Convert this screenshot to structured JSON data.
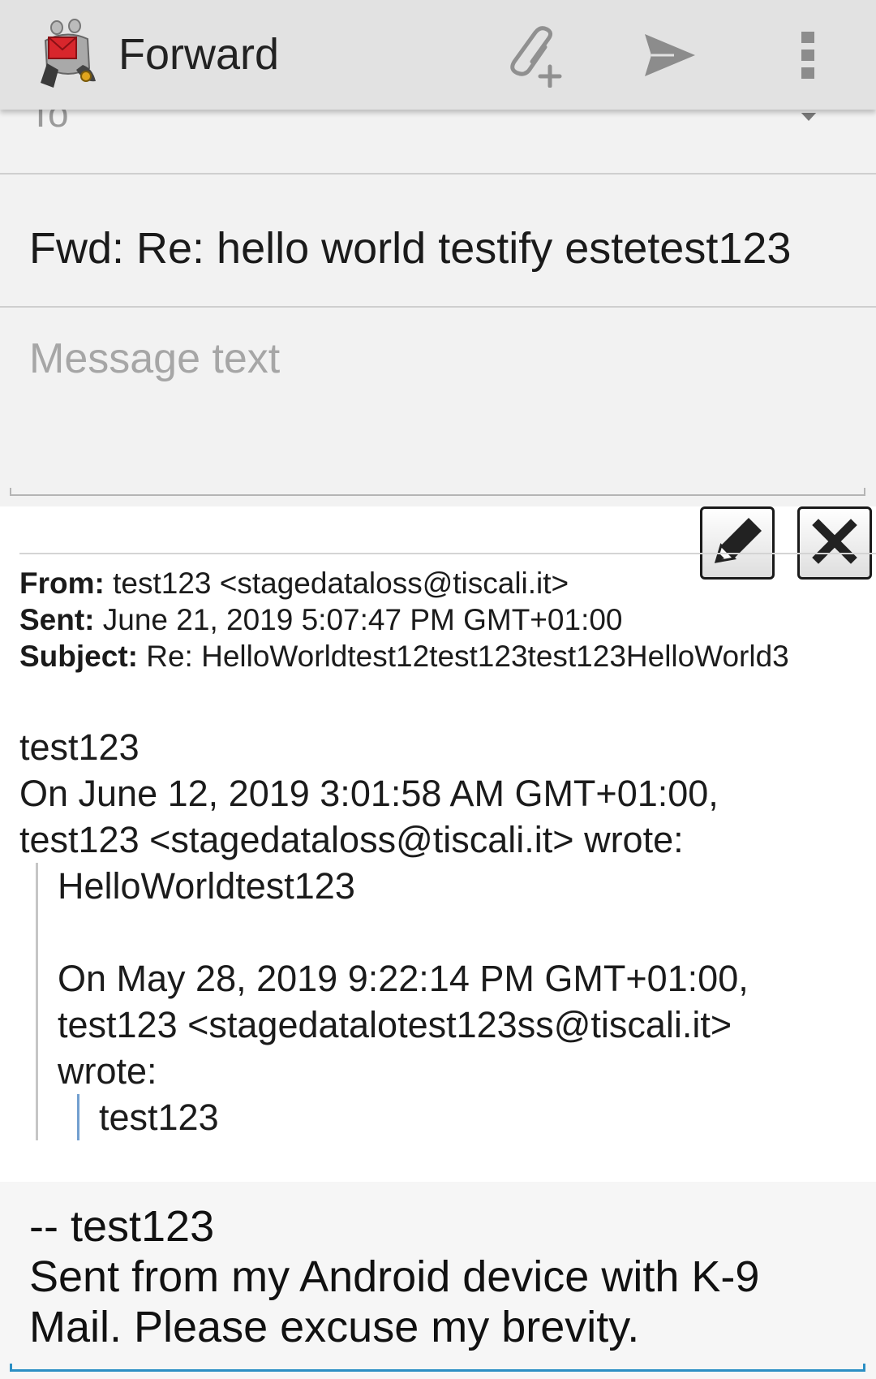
{
  "app_bar": {
    "title": "Forward",
    "logo_icon": "k9-mail-dog-logo",
    "actions": [
      {
        "name": "attach",
        "icon": "attach-add-icon"
      },
      {
        "name": "send",
        "icon": "send-icon"
      },
      {
        "name": "more",
        "icon": "overflow-menu-icon"
      }
    ]
  },
  "compose": {
    "to_label": "To",
    "subject_value": "Fwd: Re: hello world testify estetest123",
    "message_placeholder": "Message text"
  },
  "quoted": {
    "edit_icon": "pencil-icon",
    "delete_icon": "close-icon",
    "from_label": "From:",
    "from_value": "test123 <stagedataloss@tiscali.it>",
    "sent_label": "Sent:",
    "sent_value": "June 21, 2019 5:07:47 PM GMT+01:00",
    "subject_label": "Subject:",
    "subject_value": "Re: HelloWorldtest12test123test123HelloWorld3",
    "body_line1": "test123",
    "body_line2": "On June 12, 2019 3:01:58 AM GMT+01:00,",
    "body_line3": "test123 <stagedataloss@tiscali.it> wrote:",
    "quote_level1_line1": "HelloWorldtest123",
    "quote_level1_line2": "On May 28, 2019 9:22:14 PM GMT+01:00,",
    "quote_level1_line3": "test123 <stagedatalotest123ss@tiscali.it>",
    "quote_level1_line4": "wrote:",
    "quote_level2_line1": "test123"
  },
  "signature": {
    "line1": "-- test123",
    "line2": "Sent from my Android device with K-9",
    "line3": "Mail. Please excuse my brevity."
  },
  "colors": {
    "app_bar_bg": "#e2e2e2",
    "accent_underline": "#2b8fc4",
    "nested_quote_bar": "#729fcf"
  }
}
